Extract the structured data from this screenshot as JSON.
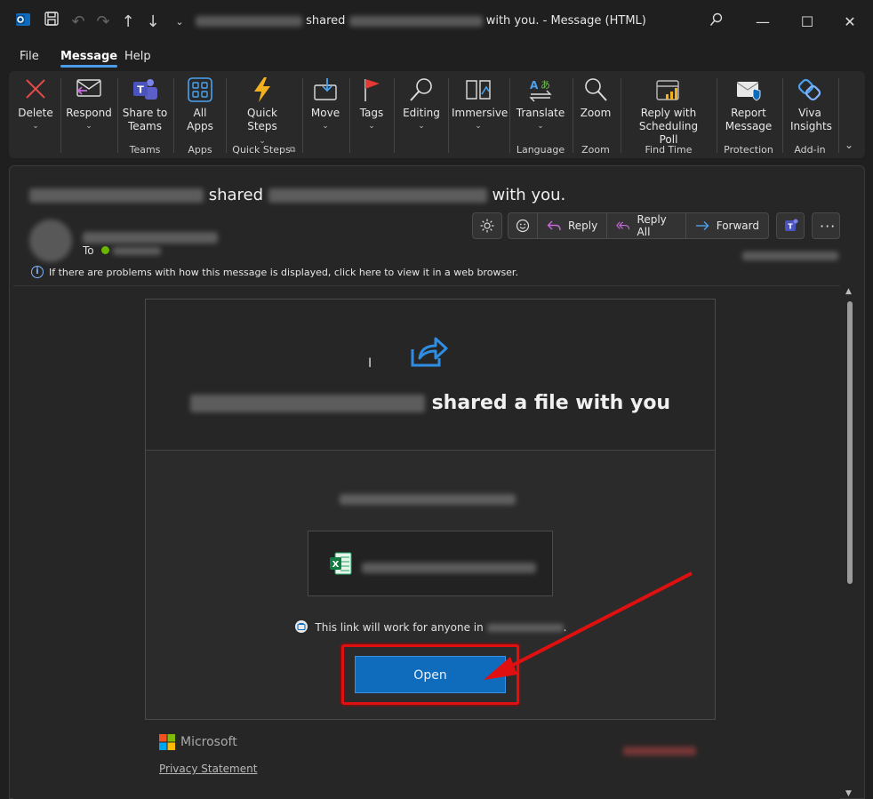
{
  "titlebar": {
    "title_shared": "shared",
    "title_with_you": "with you.",
    "title_sep": "-",
    "title_window": "Message (HTML)"
  },
  "menu": {
    "tabs": [
      "File",
      "Message",
      "Help"
    ]
  },
  "ribbon": {
    "delete": "Delete",
    "respond": "Respond",
    "share_to_teams": "Share to Teams",
    "group_teams": "Teams",
    "all_apps": "All Apps",
    "group_apps": "Apps",
    "quick_steps": "Quick Steps",
    "group_quick_steps": "Quick Steps",
    "move": "Move",
    "tags": "Tags",
    "editing": "Editing",
    "immersive": "Immersive",
    "translate": "Translate",
    "group_language": "Language",
    "zoom": "Zoom",
    "group_zoom": "Zoom",
    "scheduling_poll": "Reply with Scheduling Poll",
    "group_find_time": "Find Time",
    "report_message": "Report Message",
    "group_protection": "Protection",
    "viva_insights": "Viva Insights",
    "group_addin": "Add-in"
  },
  "message": {
    "subject_shared": "shared",
    "subject_with_you": "with you.",
    "to_label": "To",
    "actions": {
      "reply": "Reply",
      "reply_all": "Reply All",
      "forward": "Forward"
    },
    "info_text": "If there are problems with how this message is displayed, click here to view it in a web browser."
  },
  "body": {
    "heading_suffix": "shared a file with you",
    "link_note": "This link will work for anyone in",
    "open_button": "Open",
    "microsoft": "Microsoft",
    "privacy": "Privacy Statement"
  },
  "colors": {
    "accent": "#0f6cbd",
    "highlight": "#e01010"
  }
}
